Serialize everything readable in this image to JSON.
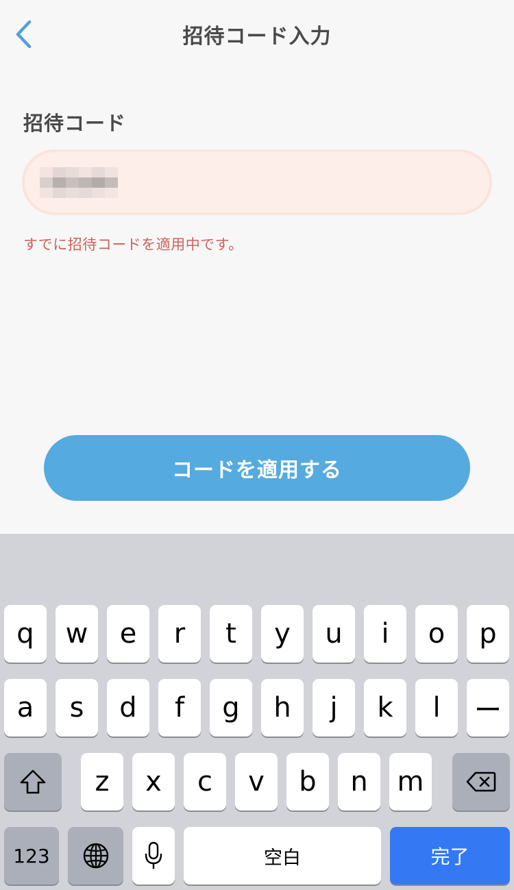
{
  "header": {
    "title": "招待コード入力",
    "back_icon": "chevron-left-icon",
    "accent_color": "#4aa3dc"
  },
  "form": {
    "label": "招待コード",
    "input_value": "",
    "input_state": "error",
    "error_message": "すでに招待コードを適用中です。",
    "error_color": "#d0605a"
  },
  "actions": {
    "apply_label": "コードを適用する",
    "apply_color": "#55aadf"
  },
  "keyboard": {
    "row1": [
      "q",
      "w",
      "e",
      "r",
      "t",
      "y",
      "u",
      "i",
      "o",
      "p"
    ],
    "row2": [
      "a",
      "s",
      "d",
      "f",
      "g",
      "h",
      "j",
      "k",
      "l",
      "ー"
    ],
    "row3": [
      "z",
      "x",
      "c",
      "v",
      "b",
      "n",
      "m"
    ],
    "shift_icon": "shift-icon",
    "backspace_icon": "backspace-icon",
    "numbers_label": "123",
    "globe_icon": "globe-icon",
    "mic_icon": "microphone-icon",
    "space_label": "空白",
    "done_label": "完了",
    "done_color": "#3479f3"
  }
}
